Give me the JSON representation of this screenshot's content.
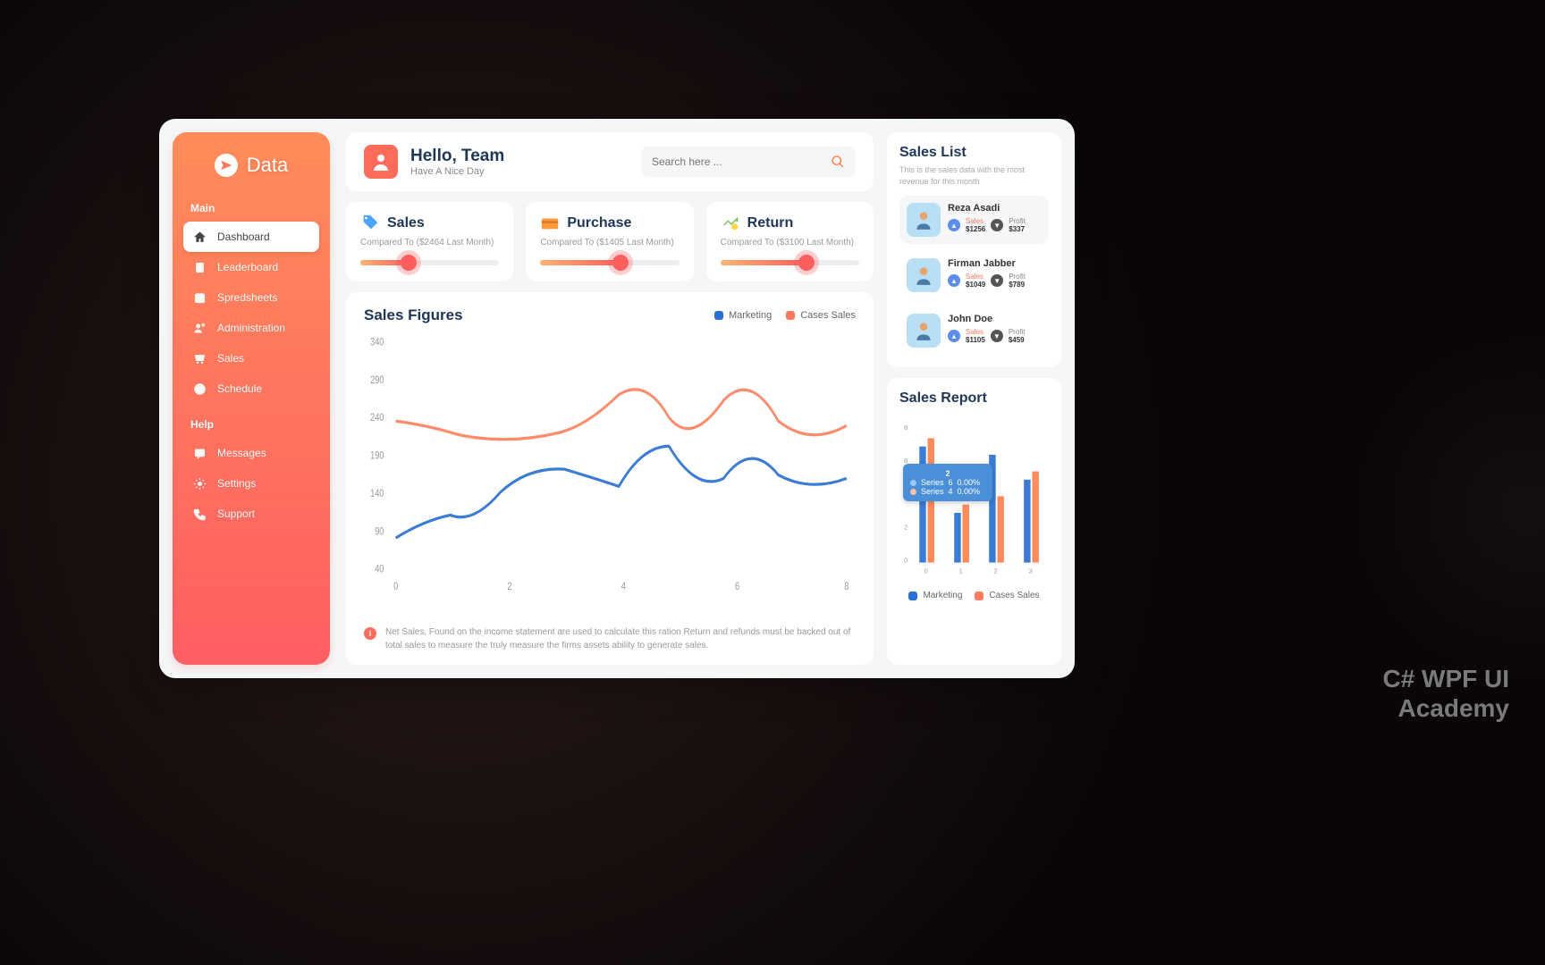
{
  "brand": "Data",
  "nav": {
    "section1_label": "Main",
    "section2_label": "Help",
    "items_main": [
      {
        "label": "Dashboard",
        "icon": "home"
      },
      {
        "label": "Leaderboard",
        "icon": "clipboard"
      },
      {
        "label": "Spredsheets",
        "icon": "calendar"
      },
      {
        "label": "Administration",
        "icon": "user-gear"
      },
      {
        "label": "Sales",
        "icon": "cart"
      },
      {
        "label": "Schedule",
        "icon": "check-circle"
      }
    ],
    "items_help": [
      {
        "label": "Messages",
        "icon": "message"
      },
      {
        "label": "Settings",
        "icon": "gear"
      },
      {
        "label": "Support",
        "icon": "phone"
      }
    ]
  },
  "header": {
    "greet": "Hello, Team",
    "sub": "Have A Nice Day",
    "search_placeholder": "Search here ..."
  },
  "kpi": [
    {
      "title": "Sales",
      "sub": "Compared To ($2464 Last Month)",
      "pct": 35,
      "icon_color": "#4aa3ff"
    },
    {
      "title": "Purchase",
      "sub": "Compared To ($1405 Last Month)",
      "pct": 58,
      "icon_color": "#ff9a3c"
    },
    {
      "title": "Return",
      "sub": "Compared To ($3100 Last Month)",
      "pct": 62,
      "icon_color": "#6bc24a"
    }
  ],
  "sales_figures": {
    "title": "Sales Figures",
    "legend": [
      {
        "label": "Marketing",
        "color": "#2a6fd6"
      },
      {
        "label": "Cases Sales",
        "color": "#ff7a5c"
      }
    ],
    "footer_note": "Net Sales, Found on the income statement are used to calculate this ration Return and refunds must be backed out of total sales to measure the truly measure the firms assets ability to generate sales."
  },
  "sales_list": {
    "title": "Sales List",
    "sub": "This is the sales data with the most revenue for this month",
    "items": [
      {
        "name": "Reza Asadi",
        "sales_lbl": "Sales",
        "sales": "$1256",
        "profit_lbl": "Profit",
        "profit": "$337"
      },
      {
        "name": "Firman Jabber",
        "sales_lbl": "Sales",
        "sales": "$1049",
        "profit_lbl": "Profit",
        "profit": "$789"
      },
      {
        "name": "John Doe",
        "sales_lbl": "Sales",
        "sales": "$1105",
        "profit_lbl": "Profit",
        "profit": "$459"
      }
    ]
  },
  "sales_report": {
    "title": "Sales Report",
    "tooltip_header": "2",
    "tooltip_rows": [
      {
        "label": "Series",
        "v1": "6",
        "v2": "0.00%",
        "color": "#9cc8f0"
      },
      {
        "label": "Series",
        "v1": "4",
        "v2": "0.00%",
        "color": "#ffc1a8"
      }
    ],
    "legend": [
      {
        "label": "Marketing",
        "color": "#2a6fd6"
      },
      {
        "label": "Cases Sales",
        "color": "#ff7a5c"
      }
    ]
  },
  "chart_data": [
    {
      "type": "line",
      "title": "Sales Figures",
      "x": [
        0,
        2,
        4,
        6,
        8
      ],
      "y_ticks": [
        40,
        90,
        140,
        190,
        240,
        290,
        340
      ],
      "series": [
        {
          "name": "Cases Sales",
          "color": "#ff7a5c",
          "values": [
            240,
            230,
            220,
            215,
            225,
            270,
            235,
            270,
            230
          ]
        },
        {
          "name": "Marketing",
          "color": "#2a6fd6",
          "values": [
            90,
            115,
            110,
            150,
            160,
            145,
            185,
            135,
            175,
            150,
            160
          ]
        }
      ]
    },
    {
      "type": "bar",
      "title": "Sales Report",
      "categories": [
        "0",
        "1",
        "2",
        "3"
      ],
      "y_ticks": [
        0,
        2,
        4,
        6,
        8
      ],
      "series": [
        {
          "name": "Marketing",
          "color": "#2a6fd6",
          "values": [
            7.0,
            3.0,
            6.5,
            5.0
          ]
        },
        {
          "name": "Cases Sales",
          "color": "#ff7a5c",
          "values": [
            7.5,
            3.5,
            4.0,
            5.5
          ]
        }
      ]
    }
  ],
  "watermark": {
    "line1": "C# WPF UI",
    "line2": "Academy"
  }
}
